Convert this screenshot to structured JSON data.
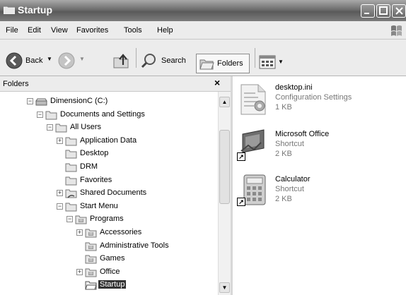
{
  "window": {
    "title": "Startup"
  },
  "menu": [
    "File",
    "Edit",
    "View",
    "Favorites",
    "Tools",
    "Help"
  ],
  "toolbar": {
    "back_label": "Back",
    "search_label": "Search",
    "folders_label": "Folders"
  },
  "folders_pane": {
    "title": "Folders",
    "close_glyph": "×",
    "tree": [
      {
        "label": "DimensionC (C:)",
        "expander": "−",
        "icon": "drive-icon"
      },
      {
        "label": "Documents and Settings",
        "expander": "−",
        "icon": "folder-icon"
      },
      {
        "label": "All Users",
        "expander": "−",
        "icon": "folder-icon"
      },
      {
        "label": "Application Data",
        "expander": "+",
        "icon": "folder-icon"
      },
      {
        "label": "Desktop",
        "expander": "",
        "icon": "folder-icon"
      },
      {
        "label": "DRM",
        "expander": "",
        "icon": "folder-icon"
      },
      {
        "label": "Favorites",
        "expander": "",
        "icon": "folder-icon"
      },
      {
        "label": "Shared Documents",
        "expander": "+",
        "icon": "shared-folder-icon"
      },
      {
        "label": "Start Menu",
        "expander": "−",
        "icon": "folder-icon"
      },
      {
        "label": "Programs",
        "expander": "−",
        "icon": "programs-folder-icon"
      },
      {
        "label": "Accessories",
        "expander": "+",
        "icon": "programs-folder-icon"
      },
      {
        "label": "Administrative Tools",
        "expander": "",
        "icon": "programs-folder-icon"
      },
      {
        "label": "Games",
        "expander": "",
        "icon": "programs-folder-icon"
      },
      {
        "label": "Office",
        "expander": "+",
        "icon": "programs-folder-icon"
      },
      {
        "label": "Startup",
        "expander": "",
        "icon": "folder-open-icon",
        "selected": true
      }
    ]
  },
  "files": [
    {
      "name": "desktop.ini",
      "type": "Configuration Settings",
      "size": "1 KB",
      "icon": "settings-file-icon"
    },
    {
      "name": "Microsoft Office",
      "type": "Shortcut",
      "size": "2 KB",
      "icon": "office-shortcut-icon"
    },
    {
      "name": "Calculator",
      "type": "Shortcut",
      "size": "2 KB",
      "icon": "calculator-icon"
    }
  ]
}
